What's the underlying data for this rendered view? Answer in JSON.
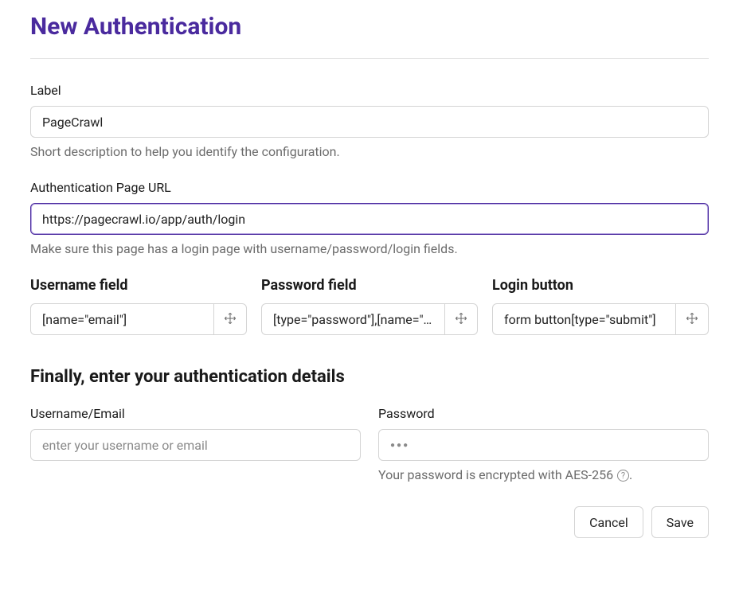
{
  "page": {
    "title": "New Authentication"
  },
  "fields": {
    "label": {
      "label": "Label",
      "value": "PageCrawl",
      "help": "Short description to help you identify the configuration."
    },
    "auth_url": {
      "label": "Authentication Page URL",
      "value": "https://pagecrawl.io/app/auth/login",
      "help": "Make sure this page has a login page with username/password/login fields."
    }
  },
  "selectors": {
    "username": {
      "heading": "Username field",
      "value": "[name=\"email\"]"
    },
    "password": {
      "heading": "Password field",
      "value": "[type=\"password\"],[name=\"password\"]"
    },
    "login": {
      "heading": "Login button",
      "value": "form button[type=\"submit\"]"
    }
  },
  "credentials": {
    "heading": "Finally, enter your authentication details",
    "username": {
      "label": "Username/Email",
      "placeholder": "enter your username or email",
      "value": ""
    },
    "password": {
      "label": "Password",
      "value": "",
      "help": "Your password is encrypted with AES-256"
    }
  },
  "actions": {
    "cancel": "Cancel",
    "save": "Save"
  }
}
